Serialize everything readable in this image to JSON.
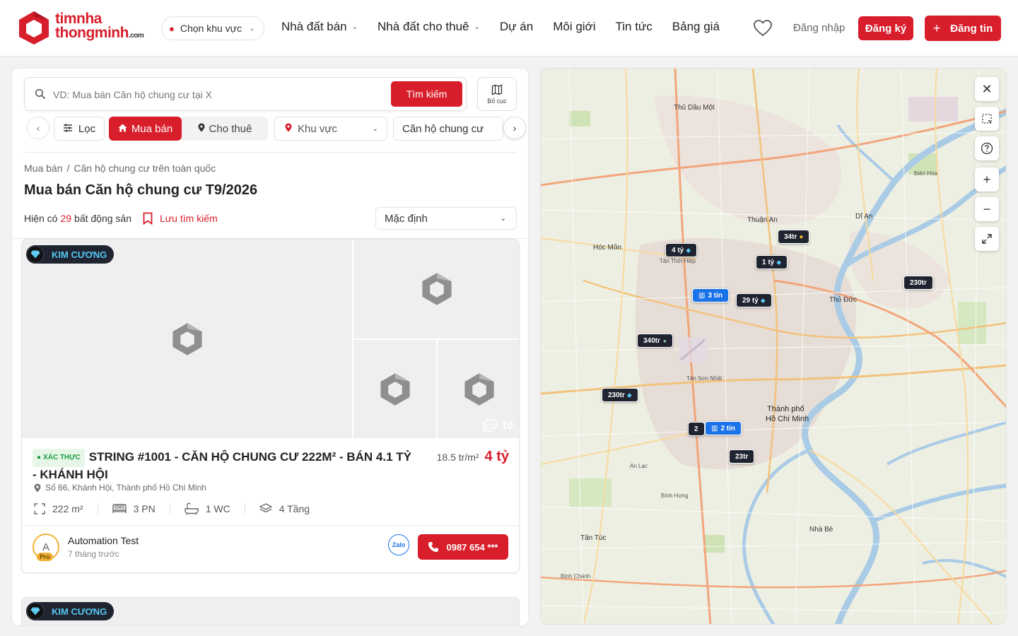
{
  "header": {
    "logo_line1": "timnha",
    "logo_line2": "thongminh",
    "logo_suffix": ".com",
    "region_label": "Chọn khu vực",
    "nav": [
      {
        "label": "Nhà đất bán"
      },
      {
        "label": "Nhà đất cho thuê"
      },
      {
        "label": "Dự án"
      },
      {
        "label": "Môi giới"
      },
      {
        "label": "Tin tức"
      },
      {
        "label": "Bảng giá"
      }
    ],
    "login_label": "Đăng nhập",
    "register_label": "Đăng ký",
    "post_label": "Đăng tin"
  },
  "search": {
    "placeholder": "VD: Mua bán Căn hộ chung cư tại X",
    "button_label": "Tìm kiếm",
    "layout_label": "Bố cục"
  },
  "filters": {
    "filter_label": "Lọc",
    "buy_label": "Mua bán",
    "rent_label": "Cho thuê",
    "area_label": "Khu vực",
    "type_label": "Căn hộ chung cư"
  },
  "breadcrumb": {
    "root": "Mua bán",
    "current": "Căn hộ chung cư trên toàn quốc"
  },
  "page_title": "Mua bán Căn hộ chung cư T9/2026",
  "results": {
    "prefix": "Hiện có",
    "count": "29",
    "suffix": "bất động sản",
    "save_label": "Lưu tìm kiếm",
    "sort_label": "Mặc định"
  },
  "listing": {
    "tier_badge": "KIM CƯƠNG",
    "image_count": "10",
    "verified_label": "XÁC THỰC",
    "title": "STRING #1001 - CĂN HỘ CHUNG CƯ 222M² - BÁN 4.1 TỶ - KHÁNH HỘI",
    "price_per_m2": "18.5 tr/m²",
    "price": "4 tỷ",
    "address": "Số 66, Khánh Hội, Thành phố Hồ Chí Minh",
    "area": "222 m²",
    "bedrooms": "3 PN",
    "bathrooms": "1 WC",
    "floors": "4 Tầng",
    "author_initial": "A",
    "author_tier": "Pro",
    "author": "Automation Test",
    "posted": "7 tháng trước",
    "zalo_label": "Zalo",
    "phone": "0987 654 ***"
  },
  "listing2": {
    "tier_badge": "KIM CƯƠNG"
  },
  "map": {
    "labels": {
      "thu_dau_mot": "Thủ Dầu Một",
      "thuan_an": "Thuận An",
      "di_an": "Dĩ An",
      "hoc_mon": "Hóc Môn",
      "thu_duc": "Thủ Đức",
      "hcm_1": "Thành phố",
      "hcm_2": "Hồ Chí Minh",
      "tan_tuc": "Tân Túc",
      "nha_be": "Nhà Bè",
      "bien_hoa": "Biên Hòa",
      "tan_thoi_hiep": "Tân Thới Hiệp",
      "binh_chanh": "Bình Chánh",
      "tan_son_nhat": "Tân Sơn Nhất",
      "binh_hung": "Bình Hưng",
      "an_lac": "An Lạc"
    },
    "markers": [
      {
        "label": "34tr",
        "mark": "●"
      },
      {
        "label": "4 tỷ",
        "mark": "◆"
      },
      {
        "label": "1 tỷ",
        "mark": "◆"
      },
      {
        "label": "230tr",
        "mark": ""
      },
      {
        "label": "3 tin",
        "mark": ""
      },
      {
        "label": "29 tỷ",
        "mark": "◆"
      },
      {
        "label": "340tr",
        "mark": "●"
      },
      {
        "label": "230tr",
        "mark": "◆"
      },
      {
        "label": "2",
        "mark": ""
      },
      {
        "label": "2 tin",
        "mark": ""
      },
      {
        "label": "23tr",
        "mark": ""
      }
    ]
  }
}
